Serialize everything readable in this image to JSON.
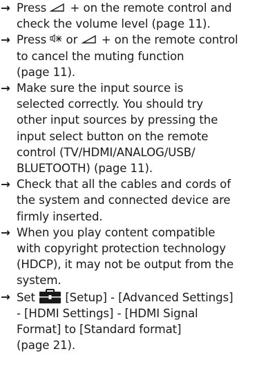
{
  "heading": "system.",
  "items": [
    {
      "lines": [
        {
          "pre": "Press ",
          "icon": "volume-up-icon",
          "post": " + on the remote control and"
        },
        {
          "pre": "check the volume level (page 11)."
        }
      ]
    },
    {
      "lines": [
        {
          "pre": "Press ",
          "icon": "mute-icon",
          "mid": " or ",
          "icon2": "volume-up-icon",
          "post": " + on the remote control"
        },
        {
          "pre": "to cancel the muting function"
        },
        {
          "pre": "(page 11)."
        }
      ]
    },
    {
      "lines": [
        {
          "pre": "Make sure the input source is"
        },
        {
          "pre": "selected correctly. You should try"
        },
        {
          "pre": "other input sources by pressing the"
        },
        {
          "pre": "input select button on the remote"
        },
        {
          "pre": "control (TV/HDMI/ANALOG/USB/"
        },
        {
          "pre": "BLUETOOTH) (page 11)."
        }
      ]
    },
    {
      "lines": [
        {
          "pre": "Check that all the cables and cords of"
        },
        {
          "pre": "the system and connected device are"
        },
        {
          "pre": "firmly inserted."
        }
      ]
    },
    {
      "lines": [
        {
          "pre": "When you play content compatible"
        },
        {
          "pre": "with copyright protection technology"
        },
        {
          "pre": "(HDCP), it may not be output from the"
        },
        {
          "pre": "system."
        }
      ]
    },
    {
      "lines": [
        {
          "pre": "Set ",
          "icon": "toolbox-icon",
          "post": " [Setup] - [Advanced Settings]"
        },
        {
          "pre": "- [HDMI Settings] - [HDMI Signal"
        },
        {
          "pre": "Format] to [Standard format]"
        },
        {
          "pre": "(page 21)."
        }
      ]
    }
  ],
  "arrow_glyph": "→"
}
